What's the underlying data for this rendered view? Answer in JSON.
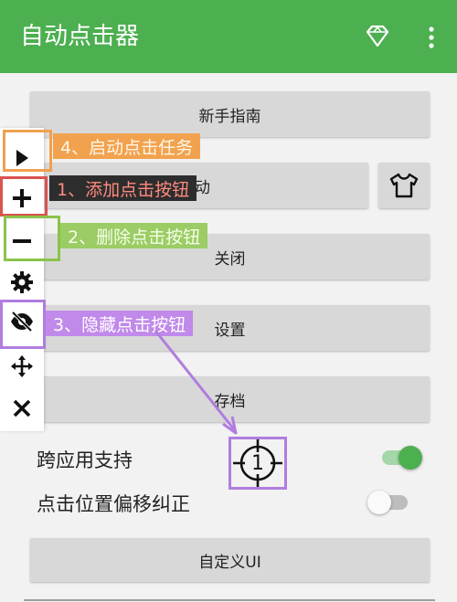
{
  "app_bar": {
    "title": "自动点击器",
    "background_color": "#4caf50",
    "icons": [
      "diamond-icon",
      "more-vert-icon"
    ]
  },
  "buttons": {
    "guide": "新手指南",
    "start_partial": "动",
    "close": "关闭",
    "settings": "设置",
    "save": "存档",
    "custom_ui": "自定义UI",
    "skin_icon": "tshirt-icon"
  },
  "toggles": [
    {
      "label": "跨应用支持",
      "state": "on"
    },
    {
      "label": "点击位置偏移纠正",
      "state": "off"
    }
  ],
  "toolbar": {
    "tools": [
      "play-icon",
      "plus-icon",
      "minus-icon",
      "gear-icon",
      "eye-off-icon",
      "move-icon",
      "close-icon"
    ]
  },
  "annotations": [
    {
      "text": "4、启动点击任务",
      "color": "#f2a24e"
    },
    {
      "text": "1、添加点击按钮",
      "color": "#d9534f"
    },
    {
      "text": "2、删除点击按钮",
      "color": "#8bc34a"
    },
    {
      "text": "3、隐藏点击按钮",
      "color": "#b07de0"
    }
  ],
  "click_target": {
    "number": "1"
  }
}
